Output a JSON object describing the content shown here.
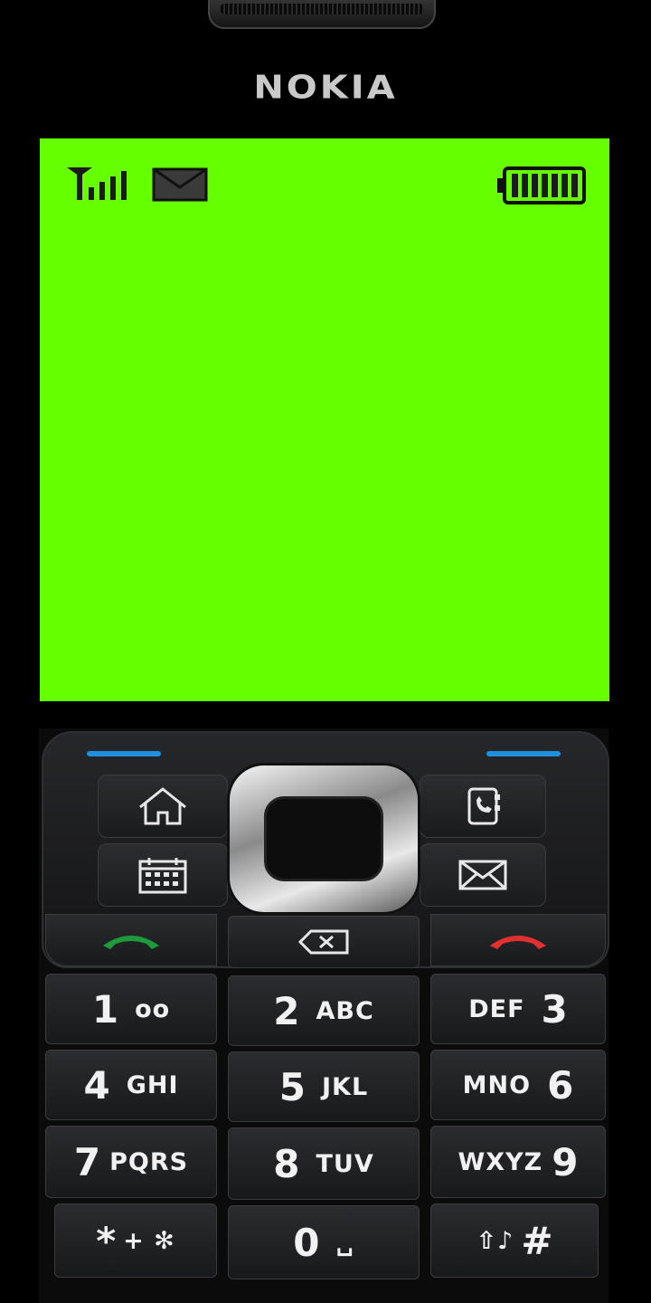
{
  "brand": "NOKIA",
  "screen_color": "#66ff00",
  "status_bar": {
    "signal": "signal-antenna-icon",
    "message": "envelope-icon",
    "battery": "battery-full-icon"
  },
  "soft_keys": {
    "home": "home-icon",
    "contacts": "contacts-phone-icon",
    "calendar": "calendar-icon",
    "messages": "envelope-icon",
    "call": "green-call-icon",
    "clear": "backspace-icon",
    "end": "red-end-call-icon"
  },
  "keys": [
    {
      "digit": "1",
      "letters": "oo"
    },
    {
      "digit": "2",
      "letters": "ABC"
    },
    {
      "digit": "3",
      "letters": "DEF"
    },
    {
      "digit": "4",
      "letters": "GHI"
    },
    {
      "digit": "5",
      "letters": "JKL"
    },
    {
      "digit": "6",
      "letters": "MNO"
    },
    {
      "digit": "7",
      "letters": "PQRS"
    },
    {
      "digit": "8",
      "letters": "TUV"
    },
    {
      "digit": "9",
      "letters": "WXYZ"
    },
    {
      "digit": "*",
      "letters": "+ ✻"
    },
    {
      "digit": "0",
      "letters": "␣"
    },
    {
      "digit": "#",
      "letters": "⇧♪"
    }
  ],
  "colors": {
    "accent_blue": "#1f8fe0",
    "call_green": "#1c9a3c",
    "end_red": "#e23030"
  }
}
